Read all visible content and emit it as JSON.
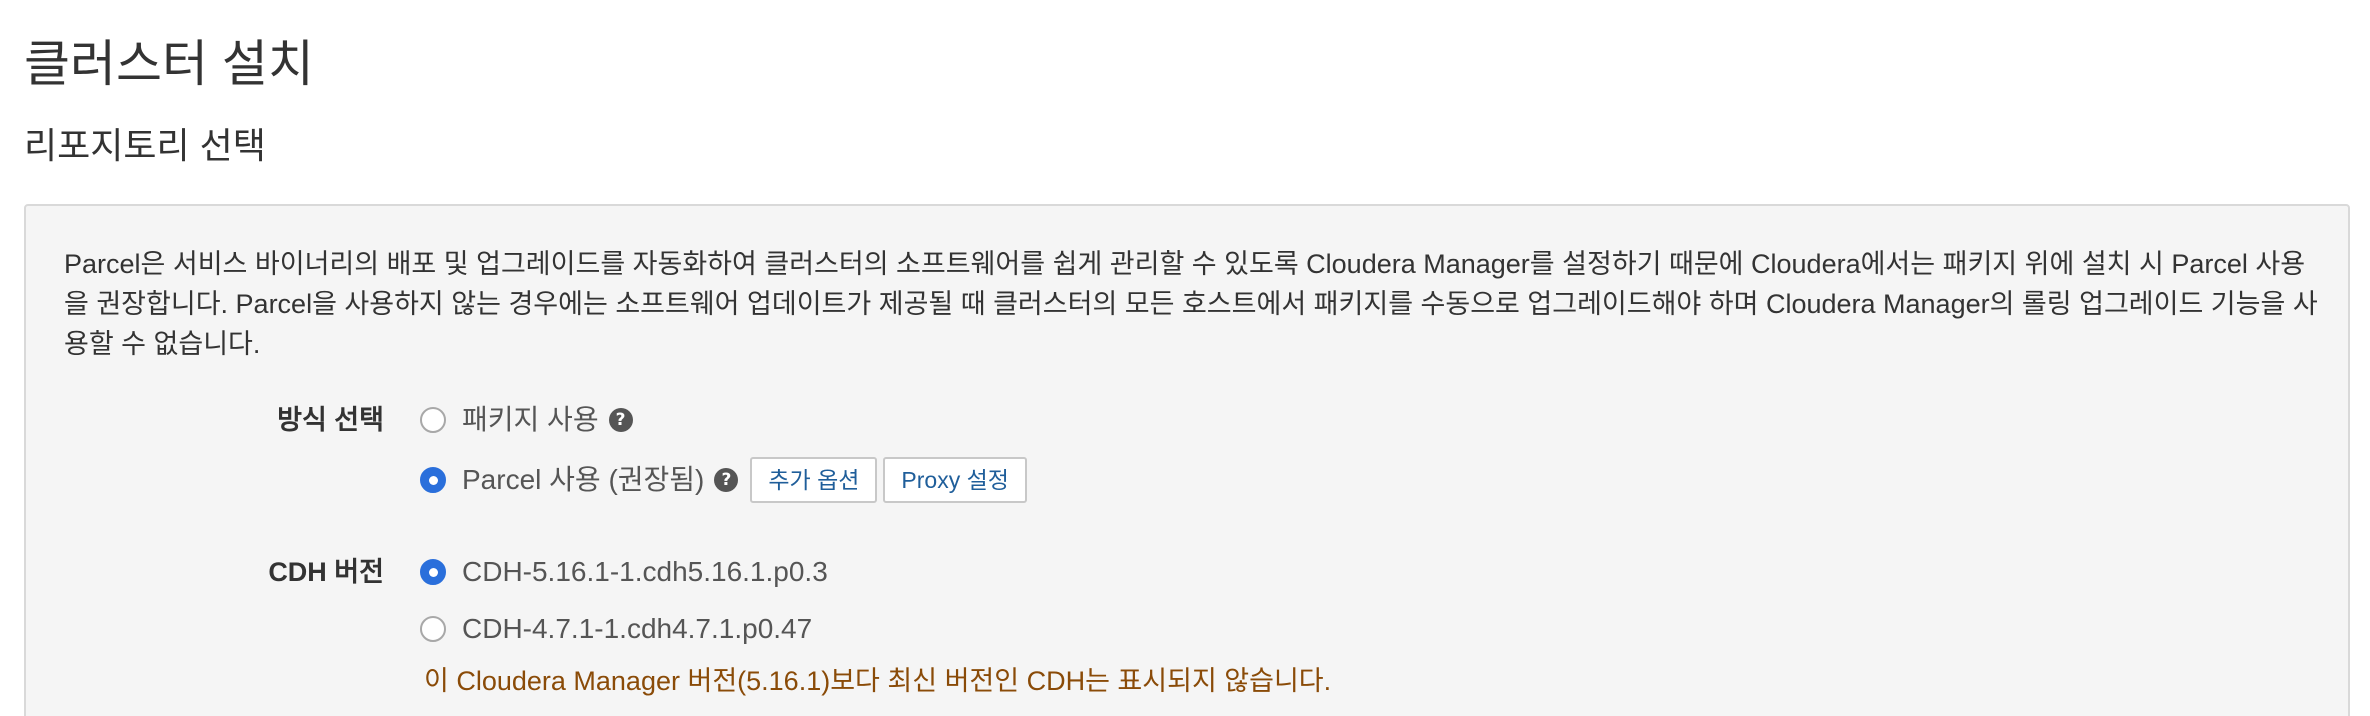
{
  "page": {
    "title": "클러스터 설치",
    "subtitle": "리포지토리 선택"
  },
  "intro": {
    "text": "Parcel은 서비스 바이너리의 배포 및 업그레이드를 자동화하여 클러스터의 소프트웨어를 쉽게 관리할 수 있도록 Cloudera Manager를 설정하기 때문에 Cloudera에서는 패키지 위에 설치 시 Parcel 사용을 권장합니다. Parcel을 사용하지 않는 경우에는 소프트웨어 업데이트가 제공될 때 클러스터의 모든 호스트에서 패키지를 수동으로 업그레이드해야 하며 Cloudera Manager의 롤링 업그레이드 기능을 사용할 수 없습니다."
  },
  "method": {
    "label": "방식 선택",
    "options": [
      {
        "label": "패키지 사용",
        "checked": false
      },
      {
        "label": "Parcel 사용 (권장됨)",
        "checked": true
      }
    ],
    "help_icon": "?",
    "more_options_label": "추가 옵션",
    "proxy_label": "Proxy 설정"
  },
  "cdh": {
    "label": "CDH 버전",
    "options": [
      {
        "label": "CDH-5.16.1-1.cdh5.16.1.p0.3",
        "checked": true
      },
      {
        "label": "CDH-4.7.1-1.cdh4.7.1.p0.47",
        "checked": false
      }
    ],
    "notice": "이 Cloudera Manager 버전(5.16.1)보다 최신 버전인 CDH는 표시되지 않습니다."
  },
  "colors": {
    "accent": "#2a6fdb",
    "link": "#1f5e9a",
    "notice": "#8a4b08",
    "panel_bg": "#f5f5f5"
  },
  "icons": [
    "radio-unchecked-icon",
    "radio-checked-icon",
    "help-icon"
  ]
}
